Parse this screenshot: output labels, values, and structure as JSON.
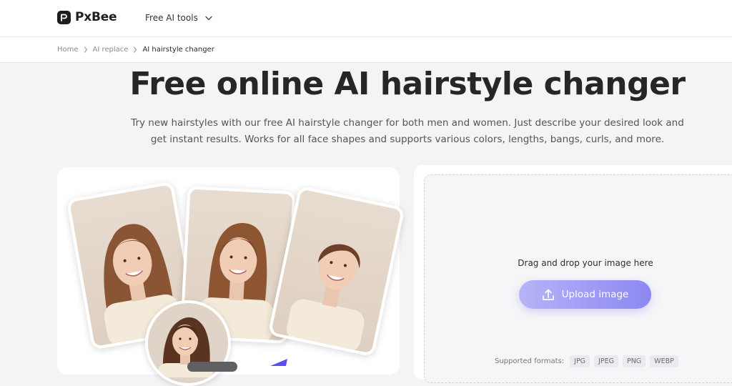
{
  "header": {
    "logo_text": "PxBee",
    "nav_tools_label": "Free AI tools"
  },
  "breadcrumb": {
    "items": [
      "Home",
      "AI replace"
    ],
    "current": "AI hairstyle changer"
  },
  "hero": {
    "title": "Free online AI hairstyle changer",
    "subtitle": "Try new hairstyles with our free AI hairstyle changer for both men and women. Just describe your desired look and get instant results. Works for all face shapes and supports various colors, lengths, bangs, curls, and more."
  },
  "upload": {
    "drop_text": "Drag and drop your image here",
    "button_label": "Upload image",
    "formats_label": "Supported formats:",
    "formats": [
      "JPG",
      "JPEG",
      "PNG",
      "WEBP"
    ]
  },
  "colors": {
    "accent": "#9f9bf5",
    "brand_dark": "#1e1e1e",
    "arrow_blue": "#5b4ff0"
  },
  "icons": [
    "logo-mark-icon",
    "chevron-down-icon",
    "chevron-right-icon",
    "upload-icon",
    "arrow-icon"
  ]
}
